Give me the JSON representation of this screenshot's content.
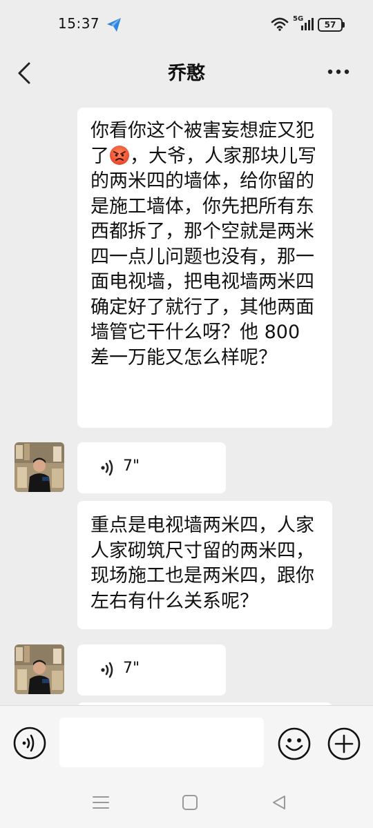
{
  "status_bar": {
    "time": "15:37",
    "network_label": "5G",
    "battery": "57",
    "app_icon": "send-icon"
  },
  "nav": {
    "title": "乔憨",
    "back_icon": "chevron-left-icon",
    "more_icon": "more-icon"
  },
  "messages": [
    {
      "type": "text",
      "side": "right",
      "text_before_emoji": "你看你这个被害妄想症又犯了",
      "emoji": "angry-face-icon",
      "text_after_emoji": "，大爷，人家那块儿写的两米四的墙体，给你留的是施工墙体，你先把所有东西都拆了，那个空就是两米四一点儿问题也没有，那一面电视墙，把电视墙两米四确定好了就行了，其他两面墙管它干什么呀？他 800 差一万能又怎么样呢？"
    },
    {
      "type": "voice",
      "side": "left",
      "duration": "7\""
    },
    {
      "type": "text",
      "side": "right",
      "text": "重点是电视墙两米四，人家人家砌筑尺寸留的两米四，现场施工也是两米四，跟你左右有什么关系呢？"
    },
    {
      "type": "voice",
      "side": "left",
      "duration": "7\""
    }
  ],
  "input_bar": {
    "placeholder": "",
    "voice_icon": "voice-mode-icon",
    "emoji_icon": "emoji-icon",
    "plus_icon": "plus-icon"
  },
  "colors": {
    "background": "#ededed",
    "bubble": "#ffffff",
    "input_bar": "#f5f5f5",
    "text": "#111111"
  }
}
